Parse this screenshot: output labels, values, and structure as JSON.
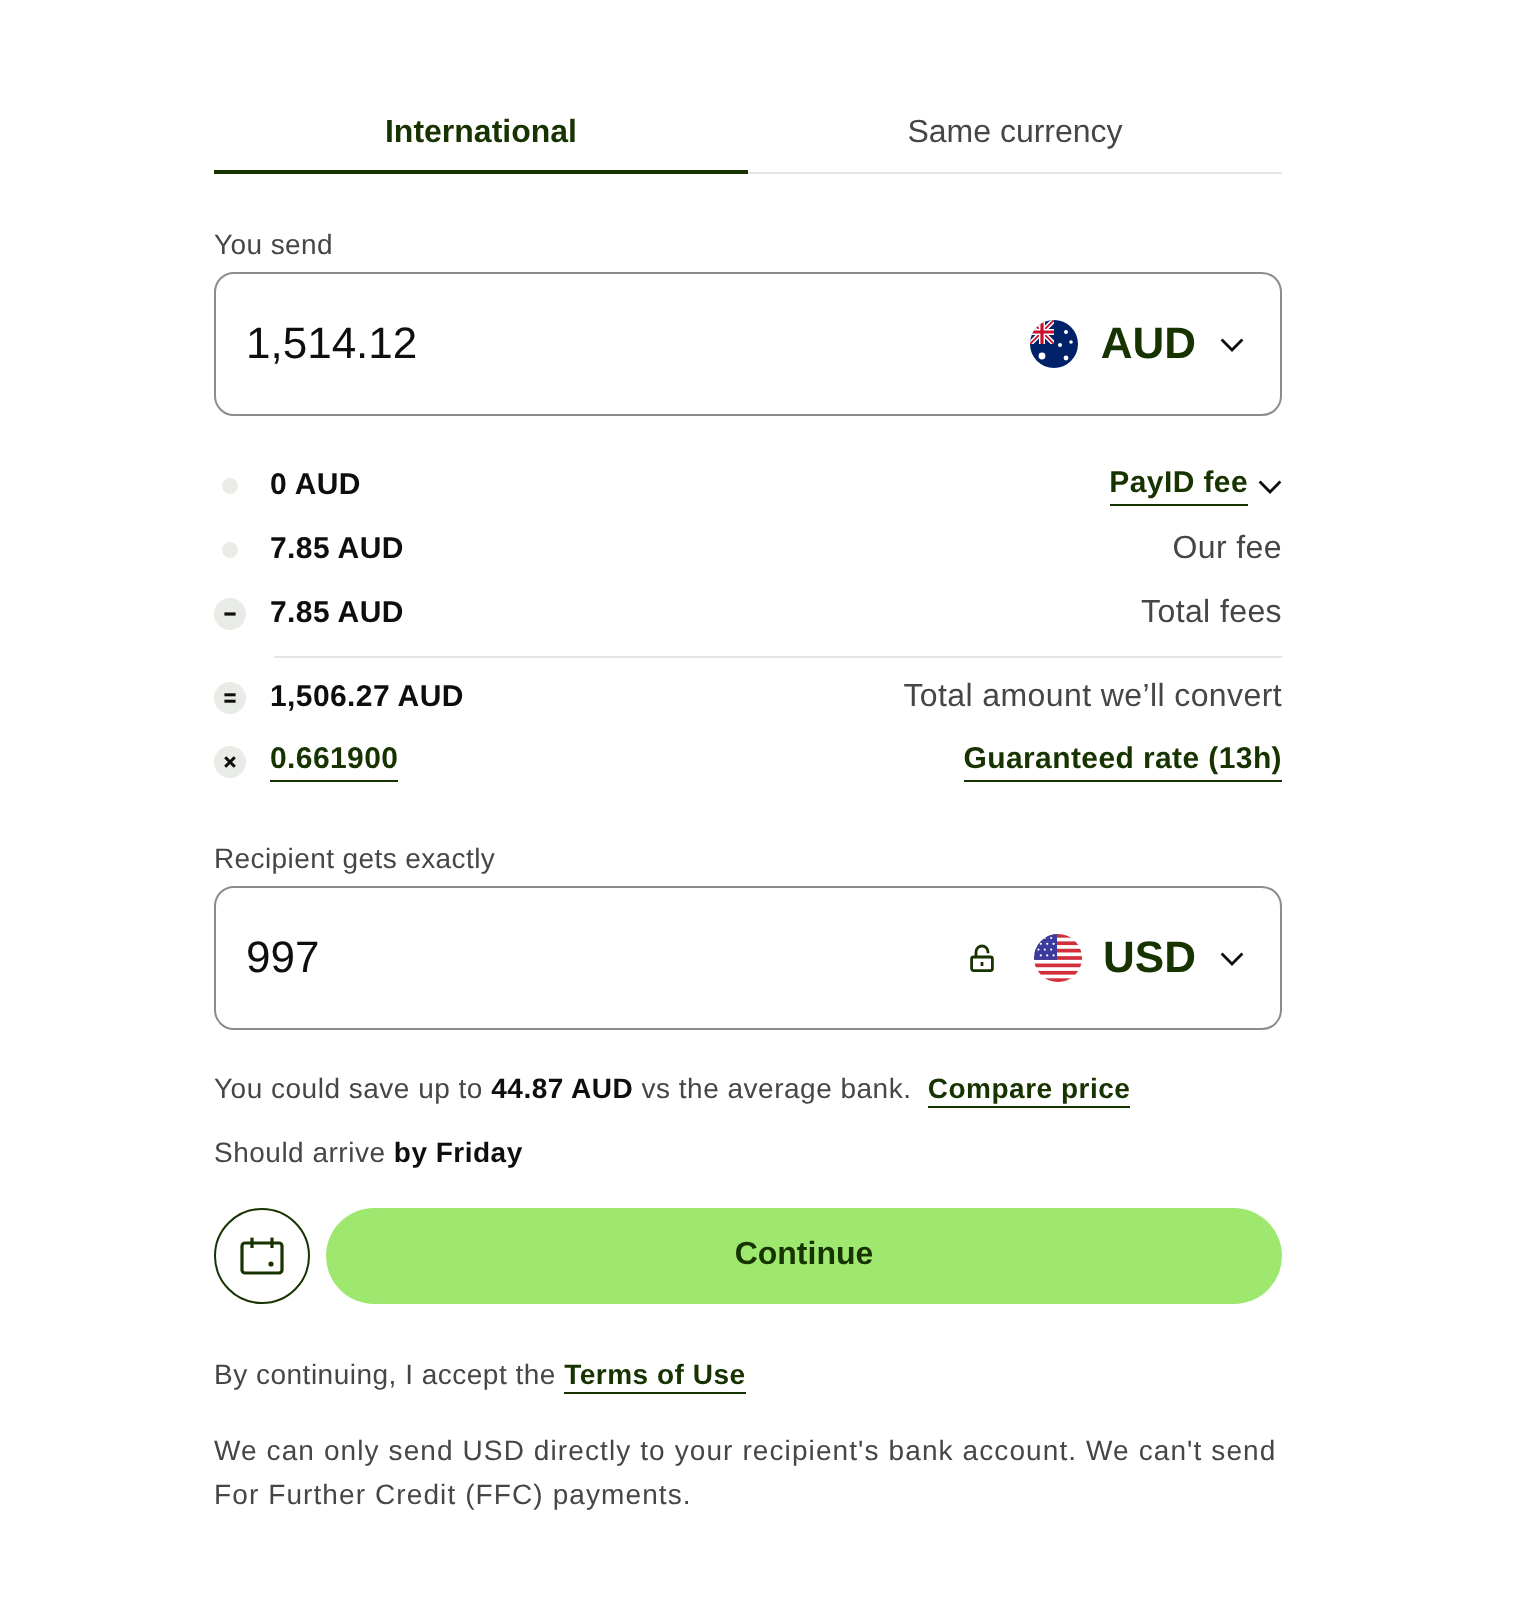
{
  "tabs": [
    {
      "label": "International",
      "selected": true
    },
    {
      "label": "Same currency",
      "selected": false
    }
  ],
  "send": {
    "label": "You send",
    "value": "1,514.12",
    "currency": "AUD"
  },
  "fees": [
    {
      "kind": "dot",
      "amount": {
        "text": "0 AUD",
        "link": false
      },
      "label": {
        "kind": "dropdown",
        "text": "PayID fee"
      }
    },
    {
      "kind": "dot",
      "amount": {
        "text": "7.85 AUD",
        "link": false
      },
      "label": {
        "kind": "plain",
        "text": "Our fee"
      }
    },
    {
      "kind": "minus",
      "amount": {
        "text": "7.85 AUD",
        "link": false
      },
      "label": {
        "kind": "plain",
        "text": "Total fees"
      }
    }
  ],
  "conversion": [
    {
      "kind": "equals",
      "amount": {
        "text": "1,506.27 AUD",
        "link": false
      },
      "label": {
        "kind": "plain",
        "text": "Total amount we’ll convert"
      }
    },
    {
      "kind": "times",
      "amount": {
        "text": "0.661900",
        "link": true
      },
      "label": {
        "kind": "link",
        "text": "Guaranteed rate (13h)"
      }
    }
  ],
  "receive": {
    "label": "Recipient gets exactly",
    "value": "997",
    "currency": "USD",
    "locked": false
  },
  "savings": {
    "text": "You could save up to **44.87 AUD** vs the average bank.",
    "link": "Compare price"
  },
  "arrival": "Should arrive **by Friday**",
  "continue_button": "Continue",
  "terms": {
    "text": "By continuing, I accept the",
    "link": "Terms of Use"
  },
  "note": "We can only send USD directly to your recipient's bank account. We can't send For Further Credit (FFC) payments."
}
